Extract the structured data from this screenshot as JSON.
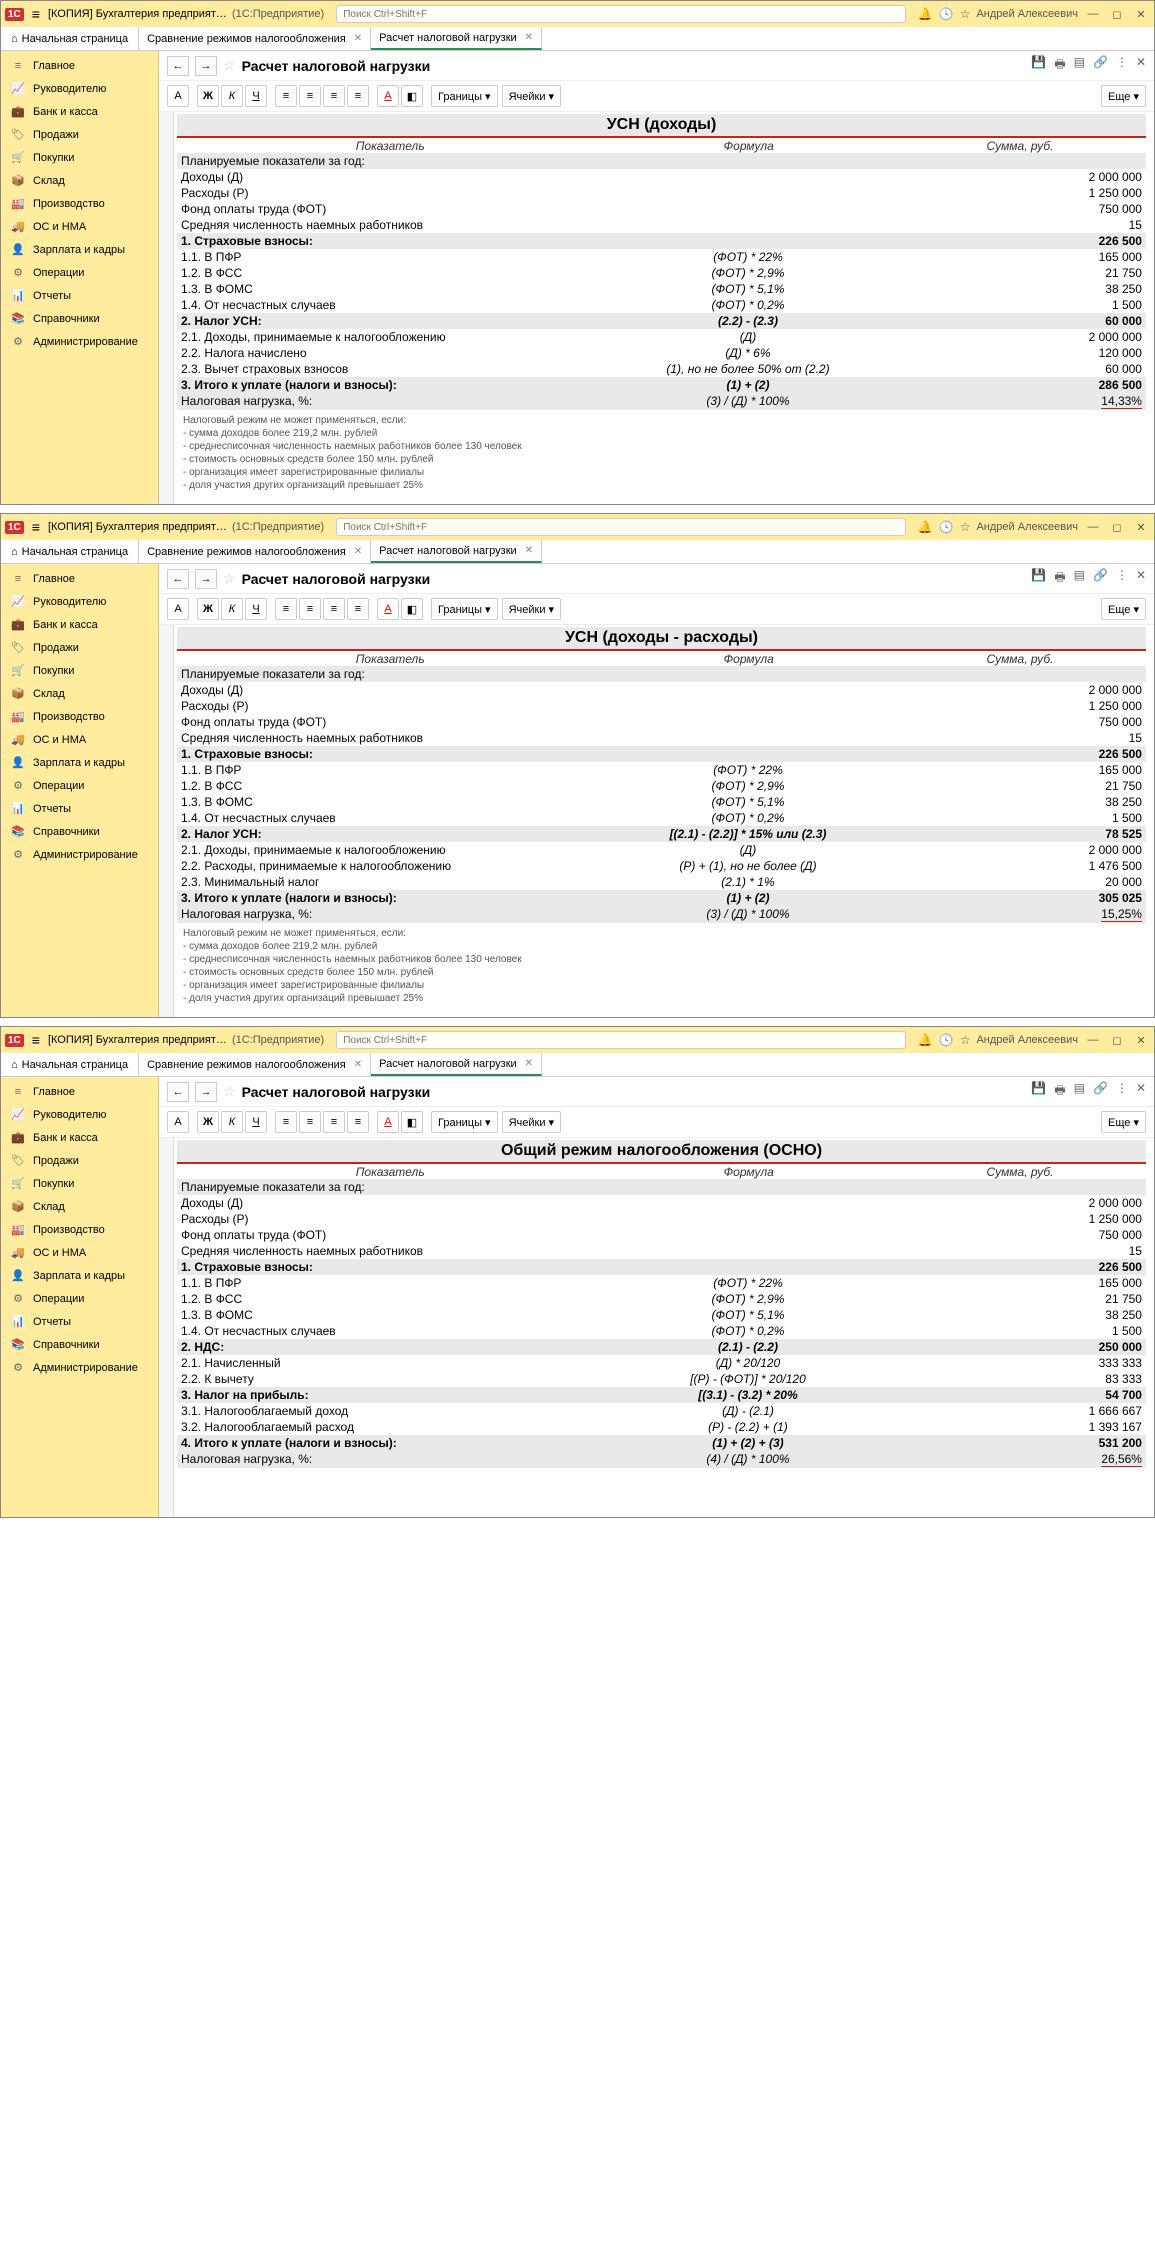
{
  "common": {
    "appTitle": "[КОПИЯ] Бухгалтерия предприятия, редак...",
    "appSub": "(1С:Предприятие)",
    "searchPlaceholder": "Поиск Ctrl+Shift+F",
    "user": "Андрей Алексеевич",
    "homeTab": "Начальная страница",
    "tab1": "Сравнение режимов налогообложения",
    "tab2": "Расчет налоговой нагрузки",
    "pageTitle": "Расчет налоговой нагрузки",
    "btnBorders": "Границы",
    "btnCells": "Ячейки",
    "btnMore": "Еще",
    "btnA": "А",
    "btnB": "Ж",
    "btnI": "К",
    "btnU": "Ч",
    "colIndicator": "Показатель",
    "colFormula": "Формула",
    "colSum": "Сумма, руб.",
    "sidebar": [
      "Главное",
      "Руководителю",
      "Банк и касса",
      "Продажи",
      "Покупки",
      "Склад",
      "Производство",
      "ОС и НМА",
      "Зарплата и кадры",
      "Операции",
      "Отчеты",
      "Справочники",
      "Администрирование"
    ],
    "sbIcons": [
      "≡",
      "📈",
      "💼",
      "🏷",
      "🛒",
      "📦",
      "🏭",
      "🚚",
      "👤",
      "⚙",
      "📊",
      "📚",
      "⚙"
    ],
    "footnoteTitle": "Налоговый режим не может применяться, если:",
    "footnotes": [
      "- сумма доходов более 219,2 млн. рублей",
      "- среднесписочная численность наемных работников более 130 человек",
      "- стоимость основных средств более 150 млн. рублей",
      "- организация имеет зарегистрированные филиалы",
      "- доля участия других организаций превышает 25%"
    ]
  },
  "shared": {
    "planHeader": "Планируемые показатели за год:",
    "rIncome": {
      "l": "Доходы (Д)",
      "v": "2 000 000"
    },
    "rExpense": {
      "l": "Расходы (Р)",
      "v": "1 250 000"
    },
    "rFot": {
      "l": "Фонд оплаты труда (ФОТ)",
      "v": "750 000"
    },
    "rHead": {
      "l": "Средняя численность наемных работников",
      "v": "15"
    },
    "s1": {
      "l": "1. Страховые взносы:",
      "v": "226 500"
    },
    "r11": {
      "l": "1.1. В ПФР",
      "f": "(ФОТ) * 22%",
      "v": "165 000"
    },
    "r12": {
      "l": "1.2. В ФСС",
      "f": "(ФОТ) * 2,9%",
      "v": "21 750"
    },
    "r13": {
      "l": "1.3. В ФОМС",
      "f": "(ФОТ) * 5,1%",
      "v": "38 250"
    },
    "r14": {
      "l": "1.4. От несчастных случаев",
      "f": "(ФОТ) * 0,2%",
      "v": "1 500"
    },
    "loadLabel": "Налоговая нагрузка, %:",
    "loadFormula": "(3) / (Д) * 100%"
  },
  "f1": {
    "title": "УСН (доходы)",
    "s2": {
      "l": "2. Налог УСН:",
      "f": "(2.2) - (2.3)",
      "v": "60 000"
    },
    "r21": {
      "l": "2.1. Доходы, принимаемые к налогообложению",
      "f": "(Д)",
      "v": "2 000 000"
    },
    "r22": {
      "l": "2.2. Налога начислено",
      "f": "(Д) * 6%",
      "v": "120 000"
    },
    "r23": {
      "l": "2.3. Вычет страховых взносов",
      "f": "(1), но не более 50% от (2.2)",
      "v": "60 000"
    },
    "s3": {
      "l": "3. Итого к уплате (налоги и взносы):",
      "f": "(1) + (2)",
      "v": "286 500"
    },
    "load": "14,33%"
  },
  "f2": {
    "title": "УСН (доходы - расходы)",
    "s2": {
      "l": "2. Налог УСН:",
      "f": "[(2.1) - (2.2)] * 15% или (2.3)",
      "v": "78 525"
    },
    "r21": {
      "l": "2.1. Доходы, принимаемые к налогообложению",
      "f": "(Д)",
      "v": "2 000 000"
    },
    "r22": {
      "l": "2.2. Расходы, принимаемые к налогообложению",
      "f": "(Р) + (1), но не более (Д)",
      "v": "1 476 500"
    },
    "r23": {
      "l": "2.3. Минимальный налог",
      "f": "(2.1) * 1%",
      "v": "20 000"
    },
    "s3": {
      "l": "3. Итого к уплате (налоги и взносы):",
      "f": "(1) + (2)",
      "v": "305 025"
    },
    "load": "15,25%"
  },
  "f3": {
    "title": "Общий режим налогообложения (ОСНО)",
    "s2": {
      "l": "2. НДС:",
      "f": "(2.1) - (2.2)",
      "v": "250 000"
    },
    "r21": {
      "l": "2.1. Начисленный",
      "f": "(Д) * 20/120",
      "v": "333 333"
    },
    "r22": {
      "l": "2.2. К вычету",
      "f": "[(Р) - (ФОТ)] * 20/120",
      "v": "83 333"
    },
    "s3": {
      "l": "3. Налог на прибыль:",
      "f": "[(3.1) - (3.2) * 20%",
      "v": "54 700"
    },
    "r31": {
      "l": "3.1. Налогооблагаемый доход",
      "f": "(Д) - (2.1)",
      "v": "1 666 667"
    },
    "r32": {
      "l": "3.2. Налогооблагаемый расход",
      "f": "(Р) - (2.2)  + (1)",
      "v": "1 393 167"
    },
    "s4": {
      "l": "4. Итого к уплате (налоги и взносы):",
      "f": "(1) + (2) + (3)",
      "v": "531 200"
    },
    "loadFormula": "(4) / (Д) * 100%",
    "load": "26,56%"
  }
}
